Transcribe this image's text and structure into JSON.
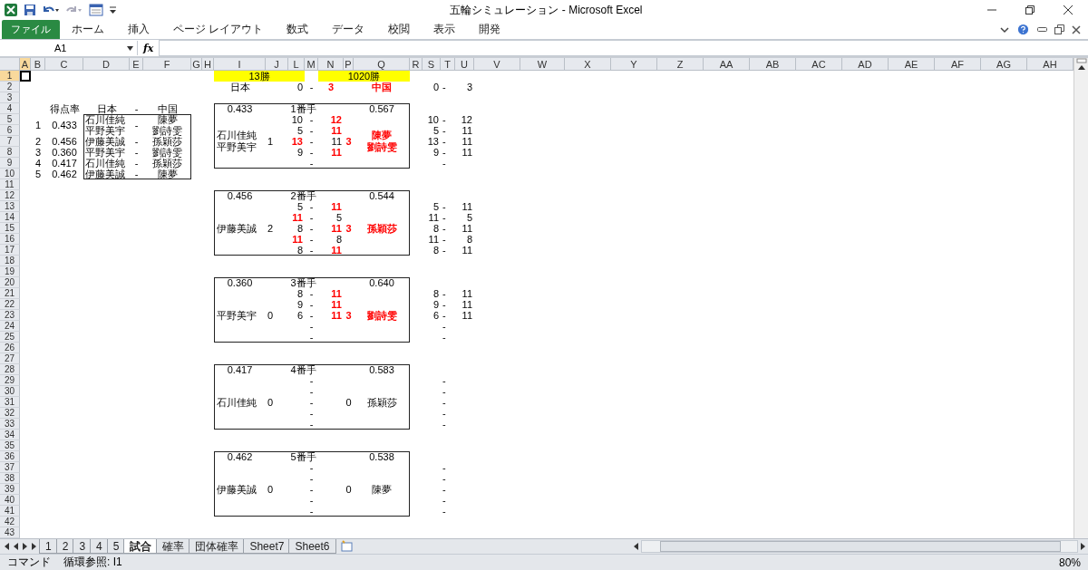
{
  "window": {
    "title": "五輪シミュレーション - Microsoft Excel"
  },
  "file_tab": "ファイル",
  "ribbon_tabs": [
    "ホーム",
    "挿入",
    "ページ レイアウト",
    "数式",
    "データ",
    "校閲",
    "表示",
    "開発"
  ],
  "formula_bar": {
    "name_box": "A1",
    "function_label": "fx"
  },
  "columns": [
    {
      "label": "A",
      "selected": true
    },
    {
      "label": "B",
      "selected": false
    },
    {
      "label": "C",
      "selected": false
    },
    {
      "label": "D",
      "selected": false
    },
    {
      "label": "E",
      "selected": false
    },
    {
      "label": "F",
      "selected": false
    },
    {
      "label": "G",
      "selected": false
    },
    {
      "label": "H",
      "selected": false
    },
    {
      "label": "I",
      "selected": false
    },
    {
      "label": "J",
      "selected": false
    },
    {
      "label": "L",
      "selected": false
    },
    {
      "label": "M",
      "selected": false
    },
    {
      "label": "N",
      "selected": false
    },
    {
      "label": "P",
      "selected": false
    },
    {
      "label": "Q",
      "selected": false
    },
    {
      "label": "R",
      "selected": false
    },
    {
      "label": "S",
      "selected": false
    },
    {
      "label": "T",
      "selected": false
    },
    {
      "label": "U",
      "selected": false
    },
    {
      "label": "V",
      "selected": false
    },
    {
      "label": "W",
      "selected": false
    },
    {
      "label": "X",
      "selected": false
    },
    {
      "label": "Y",
      "selected": false
    },
    {
      "label": "Z",
      "selected": false
    },
    {
      "label": "AA",
      "selected": false
    },
    {
      "label": "AB",
      "selected": false
    },
    {
      "label": "AC",
      "selected": false
    },
    {
      "label": "AD",
      "selected": false
    },
    {
      "label": "AE",
      "selected": false
    },
    {
      "label": "AF",
      "selected": false
    },
    {
      "label": "AG",
      "selected": false
    },
    {
      "label": "AH",
      "selected": false
    }
  ],
  "rows": [
    {
      "label": "1",
      "selected": true
    },
    {
      "label": "2",
      "selected": false
    },
    {
      "label": "3",
      "selected": false
    },
    {
      "label": "4",
      "selected": false
    },
    {
      "label": "5",
      "selected": false
    },
    {
      "label": "6",
      "selected": false
    },
    {
      "label": "7",
      "selected": false
    },
    {
      "label": "8",
      "selected": false
    },
    {
      "label": "9",
      "selected": false
    },
    {
      "label": "10",
      "selected": false
    },
    {
      "label": "11",
      "selected": false
    },
    {
      "label": "12",
      "selected": false
    },
    {
      "label": "13",
      "selected": false
    },
    {
      "label": "14",
      "selected": false
    },
    {
      "label": "15",
      "selected": false
    },
    {
      "label": "16",
      "selected": false
    },
    {
      "label": "17",
      "selected": false
    },
    {
      "label": "18",
      "selected": false
    },
    {
      "label": "19",
      "selected": false
    },
    {
      "label": "20",
      "selected": false
    },
    {
      "label": "21",
      "selected": false
    },
    {
      "label": "22",
      "selected": false
    },
    {
      "label": "23",
      "selected": false
    },
    {
      "label": "24",
      "selected": false
    },
    {
      "label": "25",
      "selected": false
    },
    {
      "label": "26",
      "selected": false
    },
    {
      "label": "27",
      "selected": false
    },
    {
      "label": "28",
      "selected": false
    },
    {
      "label": "29",
      "selected": false
    },
    {
      "label": "30",
      "selected": false
    },
    {
      "label": "31",
      "selected": false
    },
    {
      "label": "32",
      "selected": false
    },
    {
      "label": "33",
      "selected": false
    },
    {
      "label": "34",
      "selected": false
    },
    {
      "label": "35",
      "selected": false
    },
    {
      "label": "36",
      "selected": false
    },
    {
      "label": "37",
      "selected": false
    },
    {
      "label": "38",
      "selected": false
    },
    {
      "label": "39",
      "selected": false
    },
    {
      "label": "40",
      "selected": false
    },
    {
      "label": "41",
      "selected": false
    },
    {
      "label": "42",
      "selected": false
    },
    {
      "label": "43",
      "selected": false
    }
  ],
  "banners": [
    "13勝",
    "1020勝"
  ],
  "summary": {
    "jp_label": "日本",
    "jp_score": "0",
    "dash": "-",
    "cn_score": "3",
    "cn_label": "中国",
    "jp_won": false,
    "cn_won": true,
    "side_jp": "0",
    "side_dash": "-",
    "side_cn": "3"
  },
  "lineup": {
    "header": {
      "rate": "得点率",
      "jp": "日本",
      "dash": "-",
      "cn": "中国"
    },
    "rows": [
      {
        "no": "1",
        "rate": "0.433",
        "jp": [
          "石川佳純",
          "平野美宇"
        ],
        "dash": "-",
        "cn": [
          "陳夢",
          "劉詩雯"
        ]
      },
      {
        "no": "2",
        "rate": "0.456",
        "jp": [
          "伊藤美誠"
        ],
        "dash": "-",
        "cn": [
          "孫穎莎"
        ]
      },
      {
        "no": "3",
        "rate": "0.360",
        "jp": [
          "平野美宇"
        ],
        "dash": "-",
        "cn": [
          "劉詩雯"
        ]
      },
      {
        "no": "4",
        "rate": "0.417",
        "jp": [
          "石川佳純"
        ],
        "dash": "-",
        "cn": [
          "孫穎莎"
        ]
      },
      {
        "no": "5",
        "rate": "0.462",
        "jp": [
          "伊藤美誠"
        ],
        "dash": "-",
        "cn": [
          "陳夢"
        ]
      }
    ]
  },
  "matches": [
    {
      "jp_rate": "0.433",
      "label": "1番手",
      "cn_rate": "0.567",
      "jp_players": [
        "石川佳純",
        "平野美宇"
      ],
      "jp_score": "1",
      "cn_score": "3",
      "cn_players": [
        "陳夢",
        "劉詩雯"
      ],
      "jp_won": false,
      "cn_won": true,
      "games": [
        {
          "jp": "10",
          "dash": "-",
          "cn": "12",
          "jp_won": false,
          "cn_won": true
        },
        {
          "jp": "5",
          "dash": "-",
          "cn": "11",
          "jp_won": false,
          "cn_won": true
        },
        {
          "jp": "13",
          "dash": "-",
          "cn": "11",
          "jp_won": true,
          "cn_won": false
        },
        {
          "jp": "9",
          "dash": "-",
          "cn": "11",
          "jp_won": false,
          "cn_won": true
        },
        {
          "dash": "-"
        }
      ],
      "side": [
        {
          "jp": "10",
          "dash": "-",
          "cn": "12"
        },
        {
          "jp": "5",
          "dash": "-",
          "cn": "11"
        },
        {
          "jp": "13",
          "dash": "-",
          "cn": "11"
        },
        {
          "jp": "9",
          "dash": "-",
          "cn": "11"
        },
        {
          "dash": "-"
        }
      ]
    },
    {
      "jp_rate": "0.456",
      "label": "2番手",
      "cn_rate": "0.544",
      "jp_players": [
        "伊藤美誠"
      ],
      "jp_score": "2",
      "cn_score": "3",
      "cn_players": [
        "孫穎莎"
      ],
      "jp_won": false,
      "cn_won": true,
      "games": [
        {
          "jp": "5",
          "dash": "-",
          "cn": "11",
          "jp_won": false,
          "cn_won": true
        },
        {
          "jp": "11",
          "dash": "-",
          "cn": "5",
          "jp_won": true,
          "cn_won": false
        },
        {
          "jp": "8",
          "dash": "-",
          "cn": "11",
          "jp_won": false,
          "cn_won": true
        },
        {
          "jp": "11",
          "dash": "-",
          "cn": "8",
          "jp_won": true,
          "cn_won": false
        },
        {
          "jp": "8",
          "dash": "-",
          "cn": "11",
          "jp_won": false,
          "cn_won": true
        }
      ],
      "side": [
        {
          "jp": "5",
          "dash": "-",
          "cn": "11"
        },
        {
          "jp": "11",
          "dash": "-",
          "cn": "5"
        },
        {
          "jp": "8",
          "dash": "-",
          "cn": "11"
        },
        {
          "jp": "11",
          "dash": "-",
          "cn": "8"
        },
        {
          "jp": "8",
          "dash": "-",
          "cn": "11"
        }
      ]
    },
    {
      "jp_rate": "0.360",
      "label": "3番手",
      "cn_rate": "0.640",
      "jp_players": [
        "平野美宇"
      ],
      "jp_score": "0",
      "cn_score": "3",
      "cn_players": [
        "劉詩雯"
      ],
      "jp_won": false,
      "cn_won": true,
      "games": [
        {
          "jp": "8",
          "dash": "-",
          "cn": "11",
          "jp_won": false,
          "cn_won": true
        },
        {
          "jp": "9",
          "dash": "-",
          "cn": "11",
          "jp_won": false,
          "cn_won": true
        },
        {
          "jp": "6",
          "dash": "-",
          "cn": "11",
          "jp_won": false,
          "cn_won": true
        },
        {
          "dash": "-"
        },
        {
          "dash": "-"
        }
      ],
      "side": [
        {
          "jp": "8",
          "dash": "-",
          "cn": "11"
        },
        {
          "jp": "9",
          "dash": "-",
          "cn": "11"
        },
        {
          "jp": "6",
          "dash": "-",
          "cn": "11"
        },
        {
          "dash": "-"
        },
        {
          "dash": "-"
        }
      ]
    },
    {
      "jp_rate": "0.417",
      "label": "4番手",
      "cn_rate": "0.583",
      "jp_players": [
        "石川佳純"
      ],
      "jp_score": "0",
      "cn_score": "0",
      "cn_players": [
        "孫穎莎"
      ],
      "jp_won": false,
      "cn_won": false,
      "games": [
        {
          "dash": "-"
        },
        {
          "dash": "-"
        },
        {
          "dash": "-"
        },
        {
          "dash": "-"
        },
        {
          "dash": "-"
        }
      ],
      "side": [
        {
          "dash": "-"
        },
        {
          "dash": "-"
        },
        {
          "dash": "-"
        },
        {
          "dash": "-"
        },
        {
          "dash": "-"
        }
      ]
    },
    {
      "jp_rate": "0.462",
      "label": "5番手",
      "cn_rate": "0.538",
      "jp_players": [
        "伊藤美誠"
      ],
      "jp_score": "0",
      "cn_score": "0",
      "cn_players": [
        "陳夢"
      ],
      "jp_won": false,
      "cn_won": false,
      "games": [
        {
          "dash": "-"
        },
        {
          "dash": "-"
        },
        {
          "dash": "-"
        },
        {
          "dash": "-"
        },
        {
          "dash": "-"
        }
      ],
      "side": [
        {
          "dash": "-"
        },
        {
          "dash": "-"
        },
        {
          "dash": "-"
        },
        {
          "dash": "-"
        },
        {
          "dash": "-"
        }
      ]
    }
  ],
  "sheet_tabs": [
    {
      "label": "1",
      "selected": false
    },
    {
      "label": "2",
      "selected": false
    },
    {
      "label": "3",
      "selected": false
    },
    {
      "label": "4",
      "selected": false
    },
    {
      "label": "5",
      "selected": false
    },
    {
      "label": "試合",
      "selected": true
    },
    {
      "label": "確率",
      "selected": false
    },
    {
      "label": "団体確率",
      "selected": false
    },
    {
      "label": "Sheet7",
      "selected": false
    },
    {
      "label": "Sheet6",
      "selected": false
    }
  ],
  "status_bar": {
    "mode": "コマンド",
    "message": "循環参照: I1",
    "zoom": "80%"
  }
}
